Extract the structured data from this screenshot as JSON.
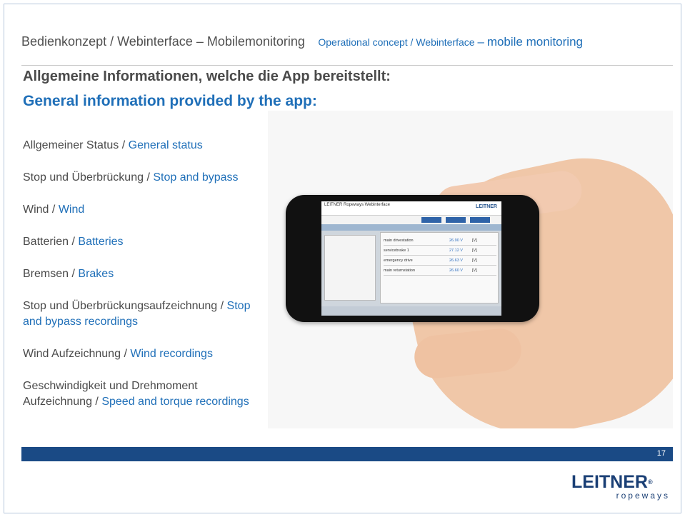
{
  "header": {
    "title_de": "Bedienkonzept  / Webinterface – Mobilemonitoring",
    "title_en": "Operational concept / Webinterface",
    "title_en_dash": "–",
    "title_en_bold": "mobile monitoring"
  },
  "heading": {
    "de": "Allgemeine Informationen, welche die App bereitstellt:",
    "en": "General information provided by the app:"
  },
  "items": [
    {
      "de": "Allgemeiner Status",
      "en": "General status"
    },
    {
      "de": "Stop und Überbrückung",
      "en": "Stop and bypass"
    },
    {
      "de": "Wind",
      "en": "Wind"
    },
    {
      "de": "Batterien",
      "en": "Batteries"
    },
    {
      "de": "Bremsen",
      "en": "Brakes"
    },
    {
      "de": "Stop und Überbrückungsaufzeichnung",
      "en": "Stop and bypass recordings"
    },
    {
      "de": "Wind Aufzeichnung",
      "en": "Wind recordings"
    },
    {
      "de": "Geschwindigkeit und Drehmoment Aufzeichnung",
      "en": "Speed and torque recordings"
    }
  ],
  "separator": "/",
  "phone_screen": {
    "title": "LEITNER Ropeways Webinterface",
    "logo": "LEITNER",
    "rows": [
      {
        "label": "main drivestation",
        "value": "26.90 V",
        "unit": "[V]"
      },
      {
        "label": "servicebrake 1",
        "value": "27.12 V",
        "unit": "[V]"
      },
      {
        "label": "emergency drive",
        "value": "26.63 V",
        "unit": "[V]"
      },
      {
        "label": "main returnstation",
        "value": "26.60 V",
        "unit": "[V]"
      }
    ]
  },
  "footer": {
    "page_number": "17",
    "logo_main": "LEITNER",
    "logo_reg": "®",
    "logo_sub": "ropeways"
  },
  "colors": {
    "accent_blue": "#1f6fb8",
    "footer_bar": "#1a4a85",
    "text_gray": "#4a4a4a"
  }
}
